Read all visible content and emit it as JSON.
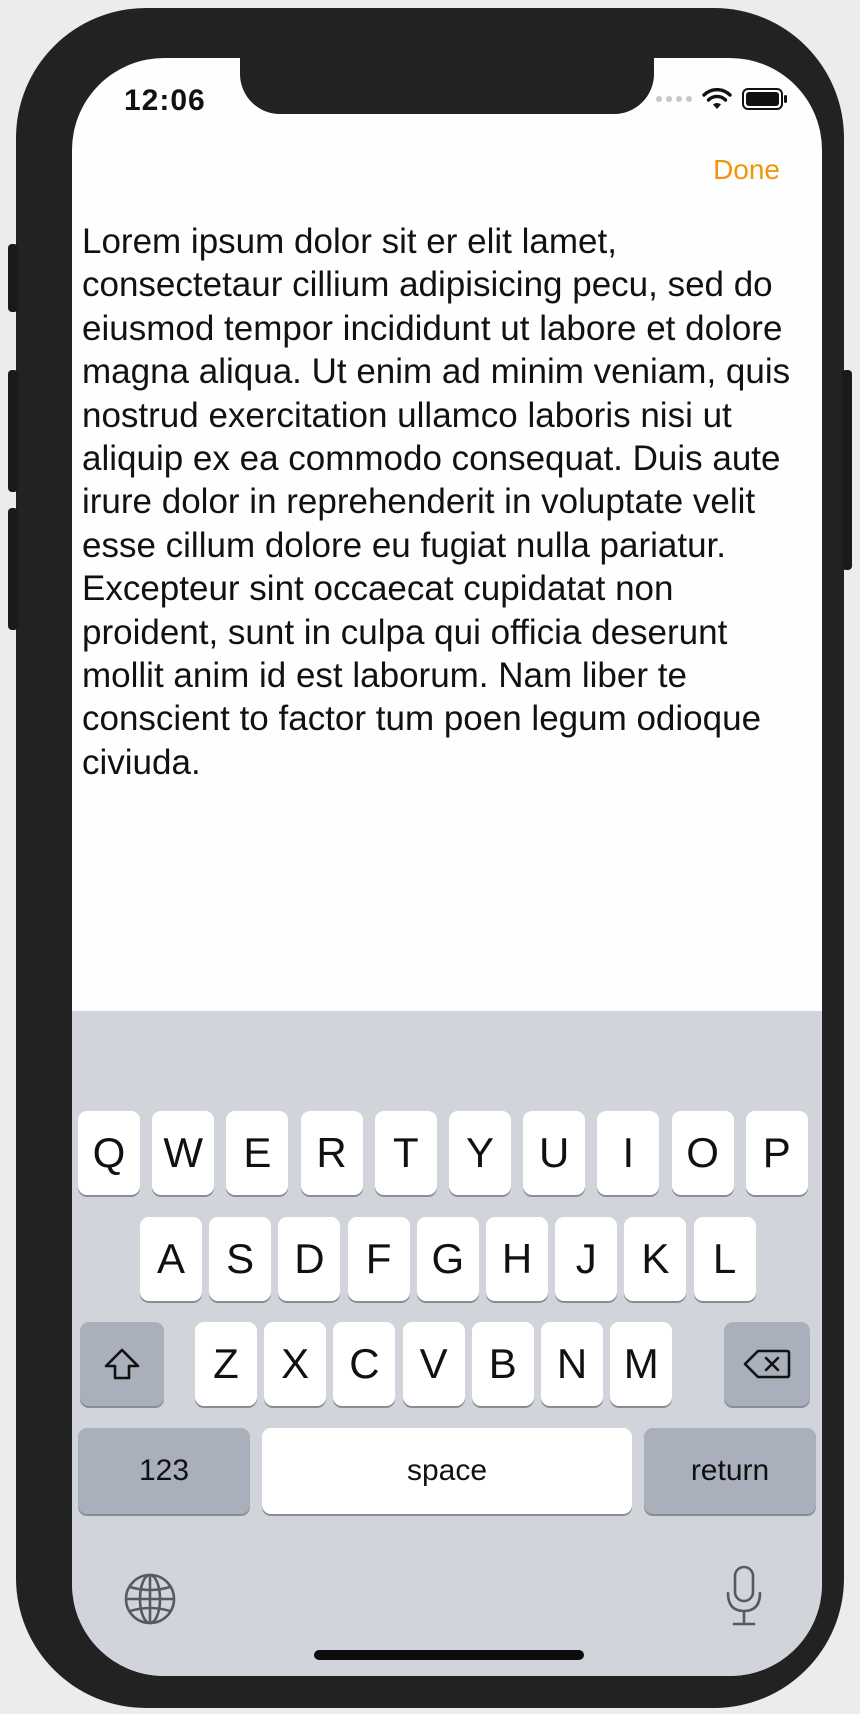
{
  "status_bar": {
    "time": "12:06",
    "icons": [
      "signal-dots-icon",
      "wifi-icon",
      "battery-icon"
    ]
  },
  "nav": {
    "done_label": "Done",
    "accent_color": "#f0960c"
  },
  "editor": {
    "text": "Lorem ipsum dolor sit er elit lamet, consectetaur cillium adipisicing pecu, sed do eiusmod tempor incididunt ut labore et dolore magna aliqua. Ut enim ad minim veniam, quis nostrud exercitation ullamco laboris nisi ut aliquip ex ea commodo consequat. Duis aute irure dolor in reprehenderit in voluptate velit esse cillum dolore eu fugiat nulla pariatur. Excepteur sint occaecat cupidatat non proident, sunt in culpa qui officia deserunt mollit anim id est laborum. Nam liber te conscient to factor tum poen legum odioque civiuda."
  },
  "keyboard": {
    "row1": [
      "Q",
      "W",
      "E",
      "R",
      "T",
      "Y",
      "U",
      "I",
      "O",
      "P"
    ],
    "row2": [
      "A",
      "S",
      "D",
      "F",
      "G",
      "H",
      "J",
      "K",
      "L"
    ],
    "row3": [
      "Z",
      "X",
      "C",
      "V",
      "B",
      "N",
      "M"
    ],
    "shift_icon": "shift-icon",
    "delete_icon": "delete-icon",
    "numbers_label": "123",
    "space_label": "space",
    "return_label": "return",
    "globe_icon": "globe-icon",
    "mic_icon": "microphone-icon"
  }
}
